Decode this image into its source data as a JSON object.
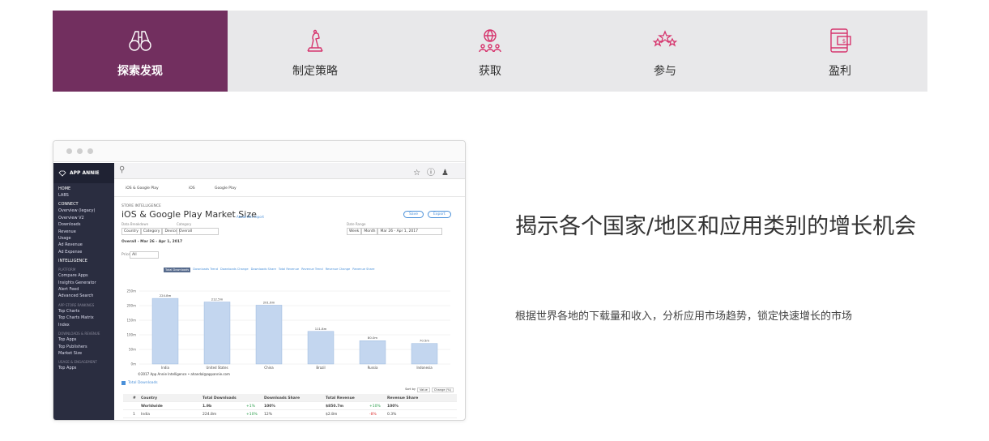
{
  "tabs": [
    {
      "label": "探索发现",
      "icon": "binoculars-icon",
      "active": true
    },
    {
      "label": "制定策略",
      "icon": "chess-piece-icon",
      "active": false
    },
    {
      "label": "获取",
      "icon": "globe-people-icon",
      "active": false
    },
    {
      "label": "参与",
      "icon": "stars-icon",
      "active": false
    },
    {
      "label": "盈利",
      "icon": "phone-dollar-icon",
      "active": false
    }
  ],
  "colors": {
    "accent": "#722f5f",
    "tab_bg": "#e8e8ea",
    "bar": "#c3d6ef",
    "bar_stroke": "#8fb0da",
    "link": "#4a90d9"
  },
  "headline": "揭示各个国家/地区和应用类别的增长机会",
  "description": "根据世界各地的下载量和收入，分析应用市场趋势，锁定快速增长的市场",
  "mock": {
    "brand": "APP ANNIE",
    "sidebar": {
      "home": "HOME",
      "labs": "LABS",
      "connect": "CONNECT",
      "connect_items": [
        "Overview (legacy)",
        "Overview V2",
        "Downloads",
        "Revenue",
        "Usage",
        "Ad Revenue",
        "Ad Expense"
      ],
      "intelligence": "INTELLIGENCE",
      "platform": "PLATFORM",
      "platform_items": [
        "Compare Apps",
        "Insights Generator",
        "Alert Feed",
        "Advanced Search"
      ],
      "store_rankings": "APP STORE RANKINGS",
      "ranking_items": [
        "Top Charts",
        "Top Charts Matrix",
        "Index"
      ],
      "downloads_revenue": "DOWNLOADS & REVENUE",
      "dr_items": [
        "Top Apps",
        "Top Publishers",
        "Market Size"
      ],
      "usage_engagement": "USAGE & ENGAGEMENT",
      "ue_items": [
        "Top Apps"
      ]
    },
    "store_tabs": [
      "iOS & Google Play",
      "iOS",
      "Google Play"
    ],
    "section_label": "STORE INTELLIGENCE",
    "page_title": "iOS & Google Play Market Size",
    "about_link": "About this report",
    "save": "Save",
    "export": "Export",
    "breakdown_label": "Data Breakdown",
    "breakdown_options": [
      "Country",
      "Category",
      "Device"
    ],
    "category_label": "Category",
    "category_value": "Overall",
    "date_label": "Date Range",
    "date_options": [
      "Week",
      "Month"
    ],
    "date_value": "Mar 26 - Apr 1, 2017",
    "summary": "Overall - Mar 26 - Apr 1, 2017",
    "price_label": "Price",
    "price_value": "All",
    "metric_tabs": [
      "Total Downloads",
      "Downloads Trend",
      "Downloads Change",
      "Downloads Share",
      "Total Revenue",
      "Revenue Trend",
      "Revenue Change",
      "Revenue Share"
    ],
    "copyright": "©2017 App Annie Intelligence • ahandal@appannie.com",
    "legend": "Total Downloads",
    "sort_label": "Sort by",
    "sort_options": [
      "Value",
      "Change (%)"
    ],
    "table_headers": [
      "#",
      "Country",
      "Total Downloads",
      "Downloads Share",
      "Total Revenue",
      "Revenue Share"
    ],
    "table_rows": [
      {
        "rank": "",
        "country": "Worldwide",
        "downloads": "1.9b",
        "change": "+1%",
        "share": "100%",
        "revenue": "$850.7m",
        "rchange": "+10%",
        "rshare": "100%"
      },
      {
        "rank": "1",
        "country": "India",
        "downloads": "224.8m",
        "change": "+10%",
        "share": "12%",
        "revenue": "$2.8m",
        "rchange": "-8%",
        "rshare": "0.3%"
      }
    ]
  },
  "chart_data": {
    "type": "bar",
    "categories": [
      "India",
      "United States",
      "China",
      "Brazil",
      "Russia",
      "Indonesia"
    ],
    "values": [
      224.8,
      212.5,
      201.6,
      111.8,
      80.0,
      70.5
    ],
    "value_labels": [
      "224.8m",
      "212.5m",
      "201.6m",
      "111.8m",
      "80.0m",
      "70.5m"
    ],
    "ytick_labels": [
      "250m",
      "200m",
      "150m",
      "100m",
      "50m",
      "0m"
    ],
    "ylim": [
      0,
      250
    ],
    "series": [
      {
        "name": "Total Downloads",
        "values": [
          224.8,
          212.5,
          201.6,
          111.8,
          80.0,
          70.5
        ]
      }
    ],
    "grid": true,
    "legend": "bottom-left"
  }
}
